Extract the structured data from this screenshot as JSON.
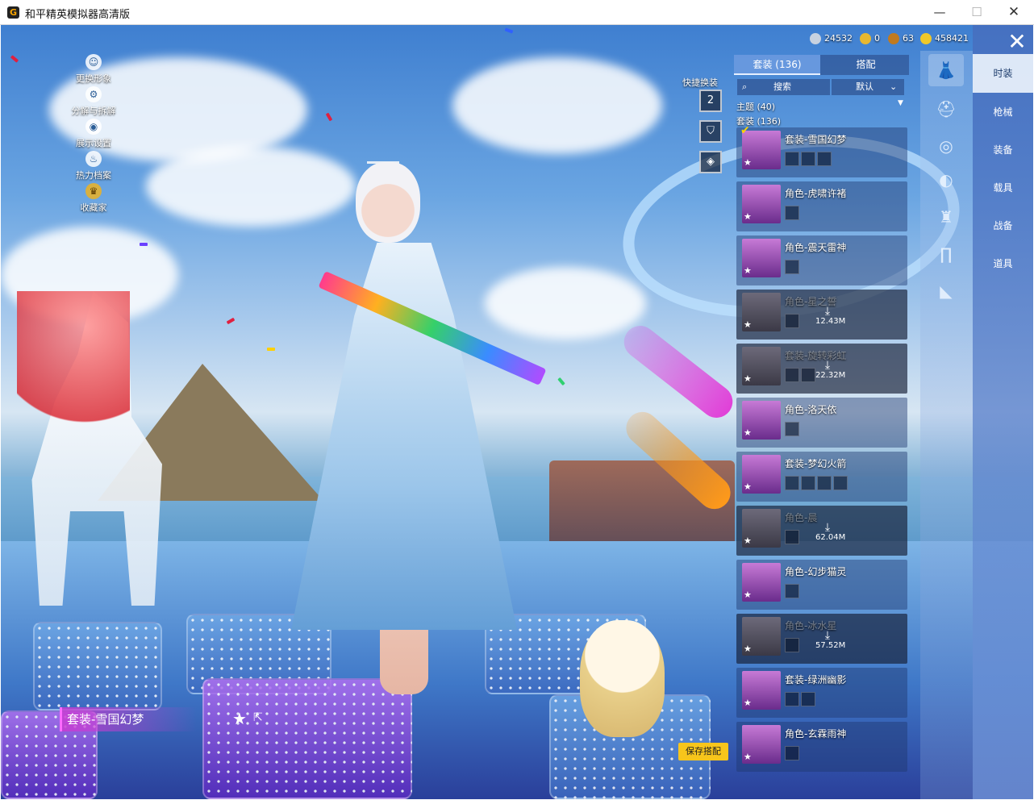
{
  "window": {
    "title": "和平精英模拟器高清版",
    "app_icon_letter": "G",
    "min_label": "—",
    "max_label": "☐",
    "close_label": "✕"
  },
  "left_menu": [
    {
      "label": "更换形象",
      "icon": "person-icon"
    },
    {
      "label": "分解与拆解",
      "icon": "gear-icon"
    },
    {
      "label": "展示设置",
      "icon": "eye-icon"
    },
    {
      "label": "热力档案",
      "icon": "flame-icon"
    },
    {
      "label": "收藏家",
      "icon": "badge-icon"
    }
  ],
  "currency": [
    {
      "value": "24532",
      "color": "#c8d2e0"
    },
    {
      "value": "0",
      "color": "#e8b830"
    },
    {
      "value": "63",
      "color": "#c07a20"
    },
    {
      "value": "458421",
      "color": "#f0c828"
    }
  ],
  "quick_swap_label": "快捷换装",
  "quick_swap_badge": "2",
  "tabs": {
    "outfit": "套装 (136)",
    "match": "搭配"
  },
  "search": {
    "placeholder": "搜索",
    "sort": "默认"
  },
  "groups": {
    "theme": "主题 (40)",
    "outfits": "套装 (136)"
  },
  "items": [
    {
      "name": "套装-雪国幻梦",
      "dim": false,
      "selected": true,
      "download": "",
      "chips": 3
    },
    {
      "name": "角色-虎啸许褚",
      "dim": false,
      "selected": false,
      "download": "",
      "chips": 1
    },
    {
      "name": "角色-震天雷神",
      "dim": false,
      "selected": false,
      "download": "",
      "chips": 1
    },
    {
      "name": "角色-星之誓",
      "dim": true,
      "selected": false,
      "download": "12.43M",
      "chips": 1
    },
    {
      "name": "套装-旋转彩虹",
      "dim": true,
      "selected": false,
      "download": "22.32M",
      "chips": 2
    },
    {
      "name": "角色-洛天依",
      "dim": false,
      "selected": false,
      "download": "",
      "chips": 1
    },
    {
      "name": "套装-梦幻火箭",
      "dim": false,
      "selected": false,
      "download": "",
      "chips": 4
    },
    {
      "name": "角色-晨",
      "dim": true,
      "selected": false,
      "download": "62.04M",
      "chips": 1
    },
    {
      "name": "角色-幻步猫灵",
      "dim": false,
      "selected": false,
      "download": "",
      "chips": 1
    },
    {
      "name": "角色-冰水星",
      "dim": true,
      "selected": false,
      "download": "57.52M",
      "chips": 1
    },
    {
      "name": "套装-绿洲幽影",
      "dim": false,
      "selected": false,
      "download": "",
      "chips": 2
    },
    {
      "name": "角色-玄霖雨神",
      "dim": false,
      "selected": false,
      "download": "",
      "chips": 1
    }
  ],
  "categories": [
    "时装",
    "枪械",
    "装备",
    "载具",
    "战备",
    "道具"
  ],
  "bottom": {
    "outfit_name": "套装-雪国幻梦",
    "save_label": "保存搭配"
  }
}
